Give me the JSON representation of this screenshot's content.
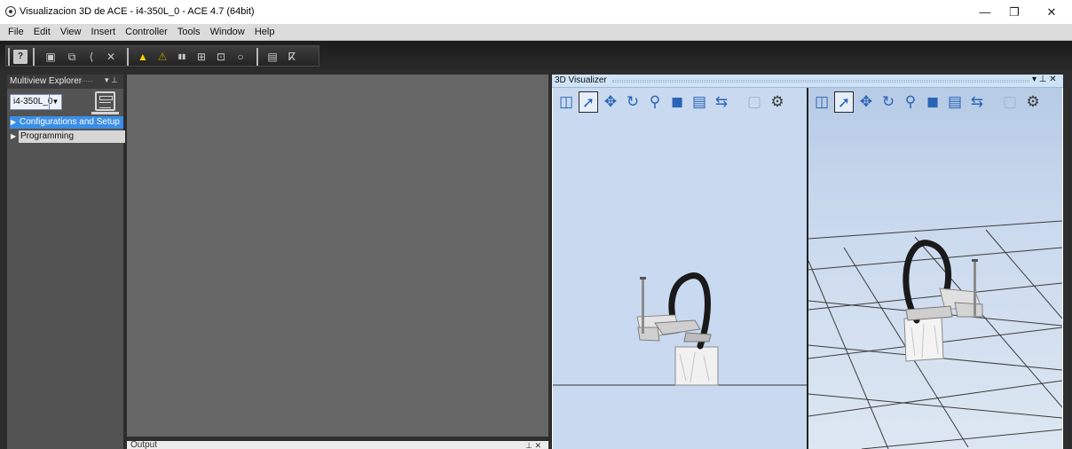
{
  "window": {
    "title": "Visualizacion 3D de ACE - i4-350L_0 - ACE 4.7 (64bit)",
    "controls": {
      "minimize": "—",
      "restore": "❐",
      "close": "✕"
    }
  },
  "menu": [
    "File",
    "Edit",
    "View",
    "Insert",
    "Controller",
    "Tools",
    "Window",
    "Help"
  ],
  "toolbar": {
    "buttons": [
      {
        "name": "help-icon",
        "glyph": "?"
      },
      {
        "name": "3d-view-icon",
        "glyph": "▣"
      },
      {
        "name": "window-icon",
        "glyph": "⧉"
      },
      {
        "name": "pointer-icon",
        "glyph": "⟨"
      },
      {
        "name": "tools-icon",
        "glyph": "✕"
      },
      {
        "name": "warning-icon",
        "glyph": "▲"
      },
      {
        "name": "warning-off-icon",
        "glyph": "⚠"
      },
      {
        "name": "pause-icon",
        "glyph": "▮▮"
      },
      {
        "name": "network-icon",
        "glyph": "⊞"
      },
      {
        "name": "connect-icon",
        "glyph": "⊡"
      },
      {
        "name": "record-icon",
        "glyph": "○"
      },
      {
        "name": "grid-icon",
        "glyph": "▤"
      },
      {
        "name": "robot-icon",
        "glyph": "ⴽ"
      }
    ]
  },
  "explorer": {
    "title": "Multiview Explorer",
    "device": "i4-350L_0",
    "dropdown_glyph": "▼",
    "pin_glyph": "▾ ⊥",
    "tree": [
      {
        "label": "Configurations and Setup",
        "arrow": "▶",
        "selected": true
      },
      {
        "label": "Programming",
        "arrow": "▶",
        "selected": false
      }
    ]
  },
  "output": {
    "title": "Output",
    "buttons": "⊥ ✕"
  },
  "visualizer": {
    "title": "3D Visualizer",
    "buttons": "▾ ⊥ ✕",
    "tools": [
      {
        "name": "split-view-icon",
        "glyph": "◫"
      },
      {
        "name": "select-arrow-icon",
        "glyph": "➚",
        "selected": true
      },
      {
        "name": "pan-icon",
        "glyph": "✥"
      },
      {
        "name": "rotate-icon",
        "glyph": "↻"
      },
      {
        "name": "zoom-icon",
        "glyph": "⚲"
      },
      {
        "name": "cube-icon",
        "glyph": "◼"
      },
      {
        "name": "properties-icon",
        "glyph": "▤"
      },
      {
        "name": "measure-icon",
        "glyph": "⇆"
      },
      {
        "name": "box-view-icon",
        "glyph": "▢",
        "dim": true
      },
      {
        "name": "camera-icon",
        "glyph": "⚙",
        "grey": true
      }
    ]
  },
  "colors": {
    "accent": "#3a8ee6",
    "viz_header": "#cfe3f6",
    "view_bg": "#c9daf0",
    "robot_arm": "#d9d9d9",
    "robot_cable": "#1a1a1a"
  }
}
